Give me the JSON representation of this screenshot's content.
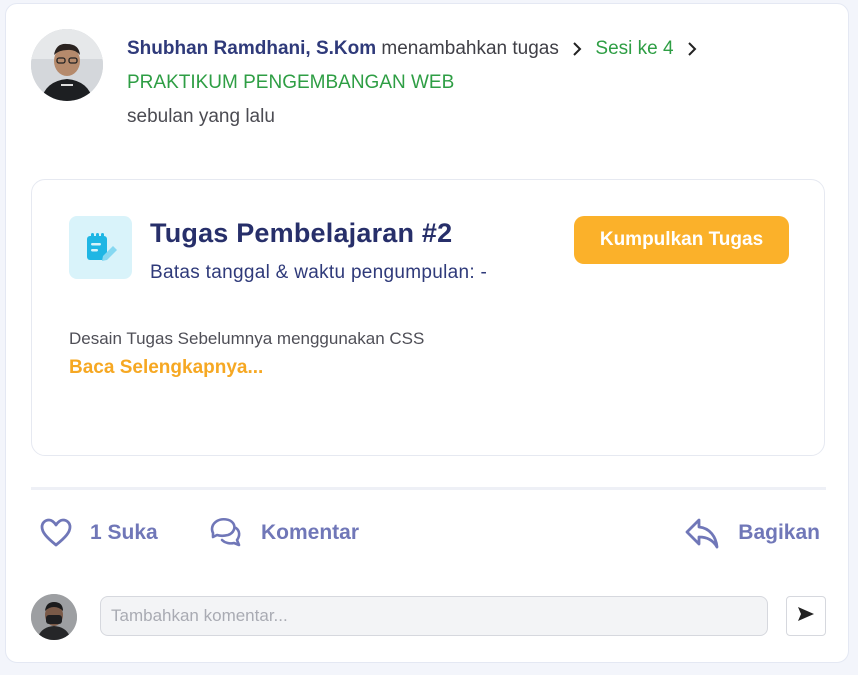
{
  "post": {
    "author": "Shubhan Ramdhani, S.Kom",
    "action_text": "menambahkan tugas",
    "session": "Sesi ke 4",
    "course": "PRAKTIKUM PENGEMBANGAN WEB",
    "time_ago": "sebulan yang lalu",
    "author_avatar_icon": "teacher-avatar"
  },
  "task": {
    "icon": "assignment-icon",
    "title": "Tugas Pembelajaran #2",
    "deadline": "Batas tanggal & waktu pengumpulan: -",
    "submit_label": "Kumpulkan Tugas",
    "description": "Desain Tugas Sebelumnya menggunakan CSS",
    "read_more": "Baca Selengkapnya..."
  },
  "actions": {
    "likes": "1 Suka",
    "comment": "Komentar",
    "share": "Bagikan"
  },
  "comment_box": {
    "placeholder": "Tambahkan komentar...",
    "send_icon": "send-icon"
  },
  "colors": {
    "author": "#2f3a7a",
    "green": "#2e9e44",
    "orange": "#fbb12a",
    "action": "#7077b8",
    "icon_bg": "#d9f3fa"
  }
}
